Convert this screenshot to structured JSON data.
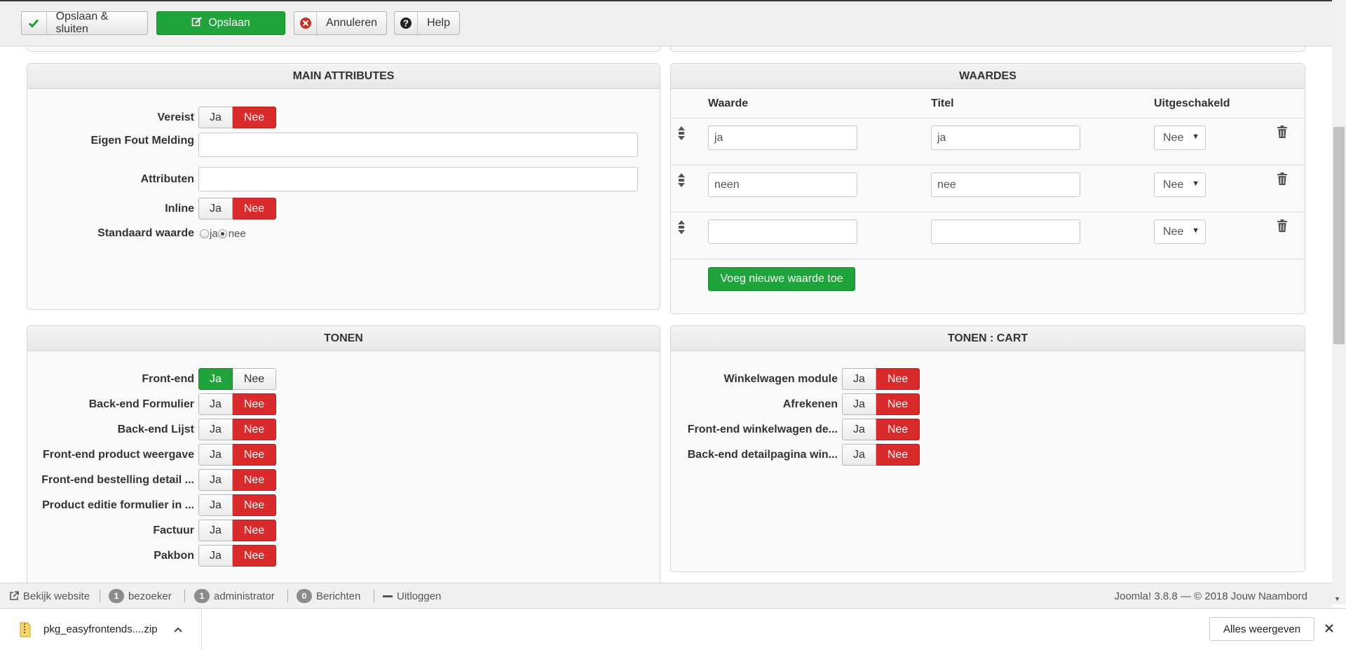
{
  "toolbar": {
    "save_close": "Opslaan & sluiten",
    "save": "Opslaan",
    "cancel": "Annuleren",
    "help": "Help"
  },
  "main_attributes": {
    "title": "MAIN ATTRIBUTES",
    "required_label": "Vereist",
    "custom_error_label": "Eigen Fout Melding",
    "custom_error_value": "",
    "attributes_label": "Attributen",
    "attributes_value": "",
    "inline_label": "Inline",
    "default_value_label": "Standaard waarde",
    "radio_option_1": "ja",
    "radio_option_2": "nee"
  },
  "toggle": {
    "yes": "Ja",
    "no": "Nee"
  },
  "waardes": {
    "title": "WAARDES",
    "col_value": "Waarde",
    "col_title": "Titel",
    "col_disabled": "Uitgeschakeld",
    "rows": [
      {
        "value": "ja",
        "title": "ja",
        "disabled": "Nee"
      },
      {
        "value": "neen",
        "title": "nee",
        "disabled": "Nee"
      },
      {
        "value": "",
        "title": "",
        "disabled": "Nee"
      }
    ],
    "add_button": "Voeg nieuwe waarde toe"
  },
  "tonen": {
    "title": "TONEN",
    "items": [
      {
        "label": "Front-end",
        "selected": "Ja"
      },
      {
        "label": "Back-end Formulier",
        "selected": "Nee"
      },
      {
        "label": "Back-end Lijst",
        "selected": "Nee"
      },
      {
        "label": "Front-end product weergave",
        "selected": "Nee"
      },
      {
        "label": "Front-end bestelling detail ...",
        "selected": "Nee"
      },
      {
        "label": "Product editie formulier in ...",
        "selected": "Nee"
      },
      {
        "label": "Factuur",
        "selected": "Nee"
      },
      {
        "label": "Pakbon",
        "selected": "Nee"
      }
    ]
  },
  "tonen_cart": {
    "title": "TONEN : CART",
    "items": [
      {
        "label": "Winkelwagen module",
        "selected": "Nee"
      },
      {
        "label": "Afrekenen",
        "selected": "Nee"
      },
      {
        "label": "Front-end winkelwagen de...",
        "selected": "Nee"
      },
      {
        "label": "Back-end detailpagina win...",
        "selected": "Nee"
      }
    ]
  },
  "statusbar": {
    "view_site": "Bekijk website",
    "visitors_count": "1",
    "visitors_label": "bezoeker",
    "admins_count": "1",
    "admins_label": "administrator",
    "messages_count": "0",
    "messages_label": "Berichten",
    "logout": "Uitloggen",
    "footer": "Joomla! 3.8.8 — © 2018 Jouw Naambord"
  },
  "downloads": {
    "filename": "pkg_easyfrontends....zip",
    "show_all": "Alles weergeven"
  },
  "colors": {
    "green": "#1fa33b",
    "red": "#d92b2b"
  }
}
